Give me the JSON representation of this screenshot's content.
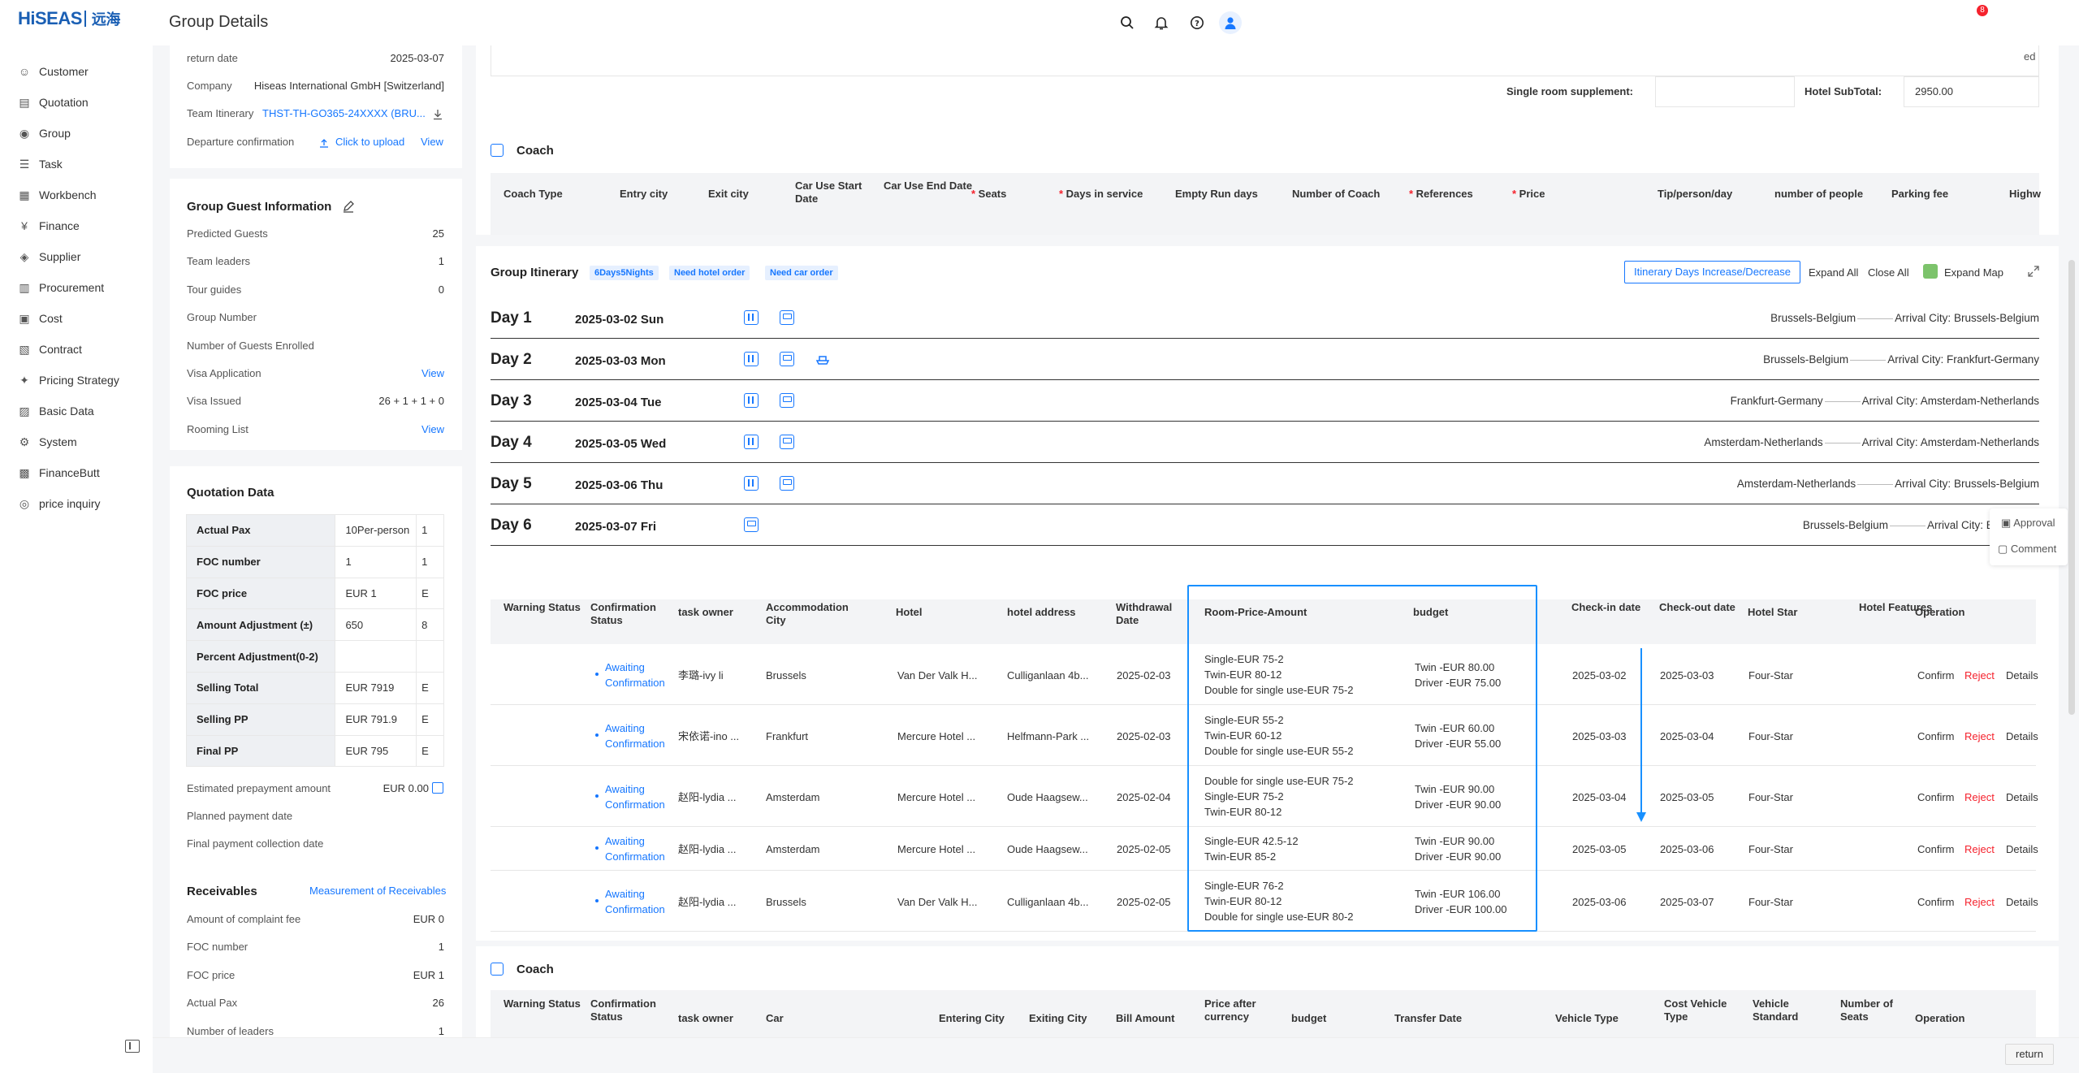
{
  "app": {
    "logo_text": "HiSEAS",
    "logo_cn": "远海",
    "page_title": "Group Details",
    "notification_count": "8"
  },
  "sidebar": {
    "items": [
      {
        "label": "Customer",
        "icon": "customer-icon"
      },
      {
        "label": "Quotation",
        "icon": "quotation-icon"
      },
      {
        "label": "Group",
        "icon": "group-icon"
      },
      {
        "label": "Task",
        "icon": "task-icon"
      },
      {
        "label": "Workbench",
        "icon": "workbench-icon"
      },
      {
        "label": "Finance",
        "icon": "finance-icon"
      },
      {
        "label": "Supplier",
        "icon": "supplier-icon"
      },
      {
        "label": "Procurement",
        "icon": "procurement-icon"
      },
      {
        "label": "Cost",
        "icon": "cost-icon"
      },
      {
        "label": "Contract",
        "icon": "contract-icon"
      },
      {
        "label": "Pricing Strategy",
        "icon": "pricing-icon"
      },
      {
        "label": "Basic Data",
        "icon": "basic-data-icon"
      },
      {
        "label": "System",
        "icon": "system-icon"
      },
      {
        "label": "FinanceButt",
        "icon": "financebutt-icon"
      },
      {
        "label": "price inquiry",
        "icon": "price-inquiry-icon"
      }
    ]
  },
  "basic": {
    "return_date_label": "return date",
    "return_date": "2025-03-07",
    "company_label": "Company",
    "company": "Hiseas International GmbH [Switzerland]",
    "itinerary_label": "Team Itinerary",
    "itinerary": "THST-TH-GO365-24XXXX (BRU...",
    "departure_label": "Departure confirmation",
    "upload": "Click to upload",
    "view": "View"
  },
  "guest_info": {
    "title": "Group Guest Information",
    "rows": [
      {
        "label": "Predicted Guests",
        "value": "25"
      },
      {
        "label": "Team leaders",
        "value": "1"
      },
      {
        "label": "Tour guides",
        "value": "0"
      },
      {
        "label": "Group Number",
        "value": ""
      },
      {
        "label": "Number of Guests Enrolled",
        "value": ""
      },
      {
        "label": "Visa Application",
        "value": "View"
      },
      {
        "label": "Visa Issued",
        "value": "26 + 1 + 1 + 0"
      },
      {
        "label": "Rooming List",
        "value": "View"
      }
    ]
  },
  "quotation": {
    "title": "Quotation Data",
    "rows": [
      {
        "label": "Actual Pax",
        "v1": "10Per-person",
        "v2": "1"
      },
      {
        "label": "FOC number",
        "v1": "1",
        "v2": "1"
      },
      {
        "label": "FOC price",
        "v1": "EUR 1",
        "v2": "E"
      },
      {
        "label": "Amount Adjustment (±)",
        "v1": "650",
        "v2": "8"
      },
      {
        "label": "Percent Adjustment(0-2)",
        "v1": "",
        "v2": ""
      },
      {
        "label": "Selling Total",
        "v1": "EUR 7919",
        "v2": "E"
      },
      {
        "label": "Selling PP",
        "v1": "EUR 791.9",
        "v2": "E"
      },
      {
        "label": "Final PP",
        "v1": "EUR 795",
        "v2": "E"
      }
    ],
    "prepay_label": "Estimated prepayment amount",
    "prepay": "EUR 0.00",
    "planned_label": "Planned payment date",
    "final_label": "Final payment collection date"
  },
  "receivables": {
    "title": "Receivables",
    "link": "Measurement of Receivables",
    "rows": [
      {
        "label": "Amount of complaint fee",
        "value": "EUR 0"
      },
      {
        "label": "FOC number",
        "value": "1"
      },
      {
        "label": "FOC price",
        "value": "EUR 1"
      },
      {
        "label": "Actual Pax",
        "value": "26"
      },
      {
        "label": "Number of leaders",
        "value": "1"
      }
    ]
  },
  "hotel_summary": {
    "tail": "ed",
    "single_label": "Single room supplement:",
    "subtotal_label": "Hotel SubTotal:",
    "subtotal": "2950.00"
  },
  "coach_top": {
    "title": "Coach",
    "headers": [
      "Coach Type",
      "Entry city",
      "Exit city",
      "Car Use Start Date",
      "Car Use End Date",
      "Seats",
      "Days in service",
      "Empty Run days",
      "Number of Coach",
      "References",
      "Price",
      "Tip/person/day",
      "number of people",
      "Parking fee",
      "Highw"
    ]
  },
  "itinerary": {
    "title": "Group Itinerary",
    "tags": [
      "6Days5Nights",
      "Need hotel order",
      "Need car order"
    ],
    "btn_days": "Itinerary Days Increase/Decrease",
    "expand_all": "Expand All",
    "close_all": "Close All",
    "expand_map": "Expand Map",
    "arrival_label": "Arrival City:",
    "days": [
      {
        "label": "Day 1",
        "date": "2025-03-02 Sun",
        "from": "Brussels-Belgium",
        "to": "Brussels-Belgium"
      },
      {
        "label": "Day 2",
        "date": "2025-03-03 Mon",
        "from": "Brussels-Belgium",
        "to": "Frankfurt-Germany"
      },
      {
        "label": "Day 3",
        "date": "2025-03-04 Tue",
        "from": "Frankfurt-Germany",
        "to": "Amsterdam-Netherlands"
      },
      {
        "label": "Day 4",
        "date": "2025-03-05 Wed",
        "from": "Amsterdam-Netherlands",
        "to": "Amsterdam-Netherlands"
      },
      {
        "label": "Day 5",
        "date": "2025-03-06 Thu",
        "from": "Amsterdam-Netherlands",
        "to": "Brussels-Belgium"
      },
      {
        "label": "Day 6",
        "date": "2025-03-07 Fri",
        "from": "Brussels-Belgium",
        "to": "Brussels-B"
      }
    ]
  },
  "float": {
    "approval": "Approval",
    "comment": "Comment"
  },
  "hotel_table": {
    "headers": [
      "Warning Status",
      "Confirmation Status",
      "task owner",
      "Accommodation City",
      "Hotel",
      "hotel address",
      "Withdrawal Date",
      "Room-Price-Amount",
      "budget",
      "Check-in date",
      "Check-out date",
      "Hotel Star",
      "Hotel Features",
      "Operation"
    ],
    "rows": [
      {
        "status": "Awaiting Confirmation",
        "owner": "李璐-ivy li",
        "city": "Brussels",
        "hotel": "Van Der Valk H...",
        "addr": "Culliganlaan 4b...",
        "withdraw": "2025-02-03",
        "rooms": [
          "Single-EUR 75-2",
          "Twin-EUR 80-12",
          "Double for single use-EUR 75-2"
        ],
        "budget": [
          "Twin -EUR 80.00",
          "Driver -EUR 75.00"
        ],
        "checkin": "2025-03-02",
        "checkout": "2025-03-03",
        "star": "Four-Star"
      },
      {
        "status": "Awaiting Confirmation",
        "owner": "宋依诺-ino ...",
        "city": "Frankfurt",
        "hotel": "Mercure Hotel ...",
        "addr": "Helfmann-Park ...",
        "withdraw": "2025-02-03",
        "rooms": [
          "Single-EUR 55-2",
          "Twin-EUR 60-12",
          "Double for single use-EUR 55-2"
        ],
        "budget": [
          "Twin -EUR 60.00",
          "Driver -EUR 55.00"
        ],
        "checkin": "2025-03-03",
        "checkout": "2025-03-04",
        "star": "Four-Star"
      },
      {
        "status": "Awaiting Confirmation",
        "owner": "赵阳-lydia ...",
        "city": "Amsterdam",
        "hotel": "Mercure Hotel ...",
        "addr": "Oude Haagsew...",
        "withdraw": "2025-02-04",
        "rooms": [
          "Double for single use-EUR 75-2",
          "Single-EUR 75-2",
          "Twin-EUR 80-12"
        ],
        "budget": [
          "Twin -EUR 90.00",
          "Driver -EUR 90.00"
        ],
        "checkin": "2025-03-04",
        "checkout": "2025-03-05",
        "star": "Four-Star"
      },
      {
        "status": "Awaiting Confirmation",
        "owner": "赵阳-lydia ...",
        "city": "Amsterdam",
        "hotel": "Mercure Hotel ...",
        "addr": "Oude Haagsew...",
        "withdraw": "2025-02-05",
        "rooms": [
          "Single-EUR 42.5-12",
          "Twin-EUR 85-2"
        ],
        "budget": [
          "Twin -EUR 90.00",
          "Driver -EUR 90.00"
        ],
        "checkin": "2025-03-05",
        "checkout": "2025-03-06",
        "star": "Four-Star"
      },
      {
        "status": "Awaiting Confirmation",
        "owner": "赵阳-lydia ...",
        "city": "Brussels",
        "hotel": "Van Der Valk H...",
        "addr": "Culliganlaan 4b...",
        "withdraw": "2025-02-05",
        "rooms": [
          "Single-EUR 76-2",
          "Twin-EUR 80-12",
          "Double for single use-EUR 80-2"
        ],
        "budget": [
          "Twin -EUR 106.00",
          "Driver -EUR 100.00"
        ],
        "checkin": "2025-03-06",
        "checkout": "2025-03-07",
        "star": "Four-Star"
      }
    ],
    "ops": {
      "confirm": "Confirm",
      "reject": "Reject",
      "details": "Details"
    }
  },
  "coach_bottom": {
    "title": "Coach",
    "headers": [
      "Warning Status",
      "Confirmation Status",
      "task owner",
      "Car",
      "Entering City",
      "Exiting City",
      "Bill Amount",
      "Price after currency",
      "budget",
      "Transfer Date",
      "Vehicle Type",
      "Cost Vehicle Type",
      "Vehicle Standard",
      "Number of Seats",
      "Operation"
    ]
  },
  "footer": {
    "return": "return"
  },
  "colors": {
    "accent": "#1677ff",
    "danger": "#f5222d",
    "highlight_border": "#1890ff"
  }
}
